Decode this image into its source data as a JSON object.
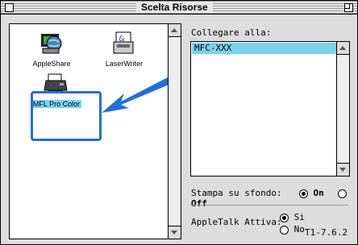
{
  "window": {
    "title": "Scelta Risorse"
  },
  "left": {
    "items": [
      {
        "label": "AppleShare",
        "icon": "appleshare-icon"
      },
      {
        "label": "LaserWriter",
        "icon": "laserwriter-icon"
      },
      {
        "label": "MFL Pro Color",
        "icon": "printer-icon"
      }
    ]
  },
  "right": {
    "connect_label": "Collegare alla:",
    "list_items": [
      "MFC-XXX"
    ],
    "background_print_label": "Stampa su sfondo:",
    "background_on": "On",
    "background_off": "Off",
    "appletalk_label": "AppleTalk Attiva:",
    "appletalk_si": "Si",
    "appletalk_no": "No",
    "version": "T1-7.6.2"
  },
  "colors": {
    "highlight": "#79d3ee",
    "selection_box": "#1d6fe0",
    "arrow": "#1d6fe0"
  }
}
